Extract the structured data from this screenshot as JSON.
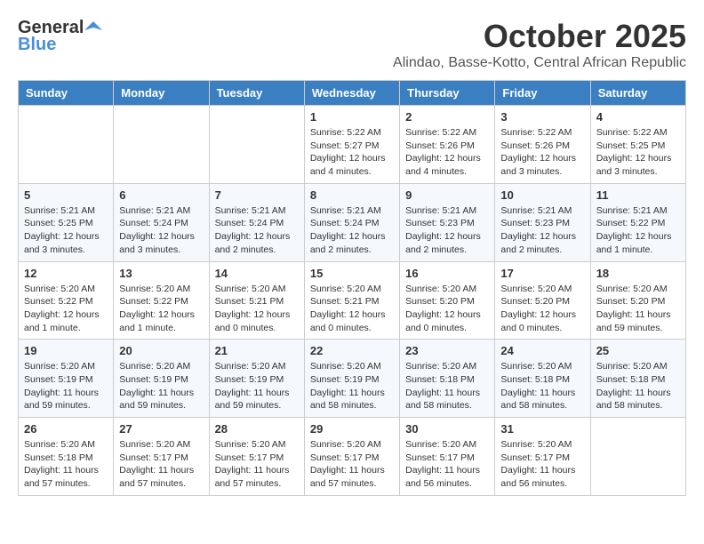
{
  "header": {
    "logo_general": "General",
    "logo_blue": "Blue",
    "month_title": "October 2025",
    "subtitle": "Alindao, Basse-Kotto, Central African Republic"
  },
  "days_of_week": [
    "Sunday",
    "Monday",
    "Tuesday",
    "Wednesday",
    "Thursday",
    "Friday",
    "Saturday"
  ],
  "weeks": [
    [
      {
        "day": "",
        "info": ""
      },
      {
        "day": "",
        "info": ""
      },
      {
        "day": "",
        "info": ""
      },
      {
        "day": "1",
        "info": "Sunrise: 5:22 AM\nSunset: 5:27 PM\nDaylight: 12 hours\nand 4 minutes."
      },
      {
        "day": "2",
        "info": "Sunrise: 5:22 AM\nSunset: 5:26 PM\nDaylight: 12 hours\nand 4 minutes."
      },
      {
        "day": "3",
        "info": "Sunrise: 5:22 AM\nSunset: 5:26 PM\nDaylight: 12 hours\nand 3 minutes."
      },
      {
        "day": "4",
        "info": "Sunrise: 5:22 AM\nSunset: 5:25 PM\nDaylight: 12 hours\nand 3 minutes."
      }
    ],
    [
      {
        "day": "5",
        "info": "Sunrise: 5:21 AM\nSunset: 5:25 PM\nDaylight: 12 hours\nand 3 minutes."
      },
      {
        "day": "6",
        "info": "Sunrise: 5:21 AM\nSunset: 5:24 PM\nDaylight: 12 hours\nand 3 minutes."
      },
      {
        "day": "7",
        "info": "Sunrise: 5:21 AM\nSunset: 5:24 PM\nDaylight: 12 hours\nand 2 minutes."
      },
      {
        "day": "8",
        "info": "Sunrise: 5:21 AM\nSunset: 5:24 PM\nDaylight: 12 hours\nand 2 minutes."
      },
      {
        "day": "9",
        "info": "Sunrise: 5:21 AM\nSunset: 5:23 PM\nDaylight: 12 hours\nand 2 minutes."
      },
      {
        "day": "10",
        "info": "Sunrise: 5:21 AM\nSunset: 5:23 PM\nDaylight: 12 hours\nand 2 minutes."
      },
      {
        "day": "11",
        "info": "Sunrise: 5:21 AM\nSunset: 5:22 PM\nDaylight: 12 hours\nand 1 minute."
      }
    ],
    [
      {
        "day": "12",
        "info": "Sunrise: 5:20 AM\nSunset: 5:22 PM\nDaylight: 12 hours\nand 1 minute."
      },
      {
        "day": "13",
        "info": "Sunrise: 5:20 AM\nSunset: 5:22 PM\nDaylight: 12 hours\nand 1 minute."
      },
      {
        "day": "14",
        "info": "Sunrise: 5:20 AM\nSunset: 5:21 PM\nDaylight: 12 hours\nand 0 minutes."
      },
      {
        "day": "15",
        "info": "Sunrise: 5:20 AM\nSunset: 5:21 PM\nDaylight: 12 hours\nand 0 minutes."
      },
      {
        "day": "16",
        "info": "Sunrise: 5:20 AM\nSunset: 5:20 PM\nDaylight: 12 hours\nand 0 minutes."
      },
      {
        "day": "17",
        "info": "Sunrise: 5:20 AM\nSunset: 5:20 PM\nDaylight: 12 hours\nand 0 minutes."
      },
      {
        "day": "18",
        "info": "Sunrise: 5:20 AM\nSunset: 5:20 PM\nDaylight: 11 hours\nand 59 minutes."
      }
    ],
    [
      {
        "day": "19",
        "info": "Sunrise: 5:20 AM\nSunset: 5:19 PM\nDaylight: 11 hours\nand 59 minutes."
      },
      {
        "day": "20",
        "info": "Sunrise: 5:20 AM\nSunset: 5:19 PM\nDaylight: 11 hours\nand 59 minutes."
      },
      {
        "day": "21",
        "info": "Sunrise: 5:20 AM\nSunset: 5:19 PM\nDaylight: 11 hours\nand 59 minutes."
      },
      {
        "day": "22",
        "info": "Sunrise: 5:20 AM\nSunset: 5:19 PM\nDaylight: 11 hours\nand 58 minutes."
      },
      {
        "day": "23",
        "info": "Sunrise: 5:20 AM\nSunset: 5:18 PM\nDaylight: 11 hours\nand 58 minutes."
      },
      {
        "day": "24",
        "info": "Sunrise: 5:20 AM\nSunset: 5:18 PM\nDaylight: 11 hours\nand 58 minutes."
      },
      {
        "day": "25",
        "info": "Sunrise: 5:20 AM\nSunset: 5:18 PM\nDaylight: 11 hours\nand 58 minutes."
      }
    ],
    [
      {
        "day": "26",
        "info": "Sunrise: 5:20 AM\nSunset: 5:18 PM\nDaylight: 11 hours\nand 57 minutes."
      },
      {
        "day": "27",
        "info": "Sunrise: 5:20 AM\nSunset: 5:17 PM\nDaylight: 11 hours\nand 57 minutes."
      },
      {
        "day": "28",
        "info": "Sunrise: 5:20 AM\nSunset: 5:17 PM\nDaylight: 11 hours\nand 57 minutes."
      },
      {
        "day": "29",
        "info": "Sunrise: 5:20 AM\nSunset: 5:17 PM\nDaylight: 11 hours\nand 57 minutes."
      },
      {
        "day": "30",
        "info": "Sunrise: 5:20 AM\nSunset: 5:17 PM\nDaylight: 11 hours\nand 56 minutes."
      },
      {
        "day": "31",
        "info": "Sunrise: 5:20 AM\nSunset: 5:17 PM\nDaylight: 11 hours\nand 56 minutes."
      },
      {
        "day": "",
        "info": ""
      }
    ]
  ]
}
